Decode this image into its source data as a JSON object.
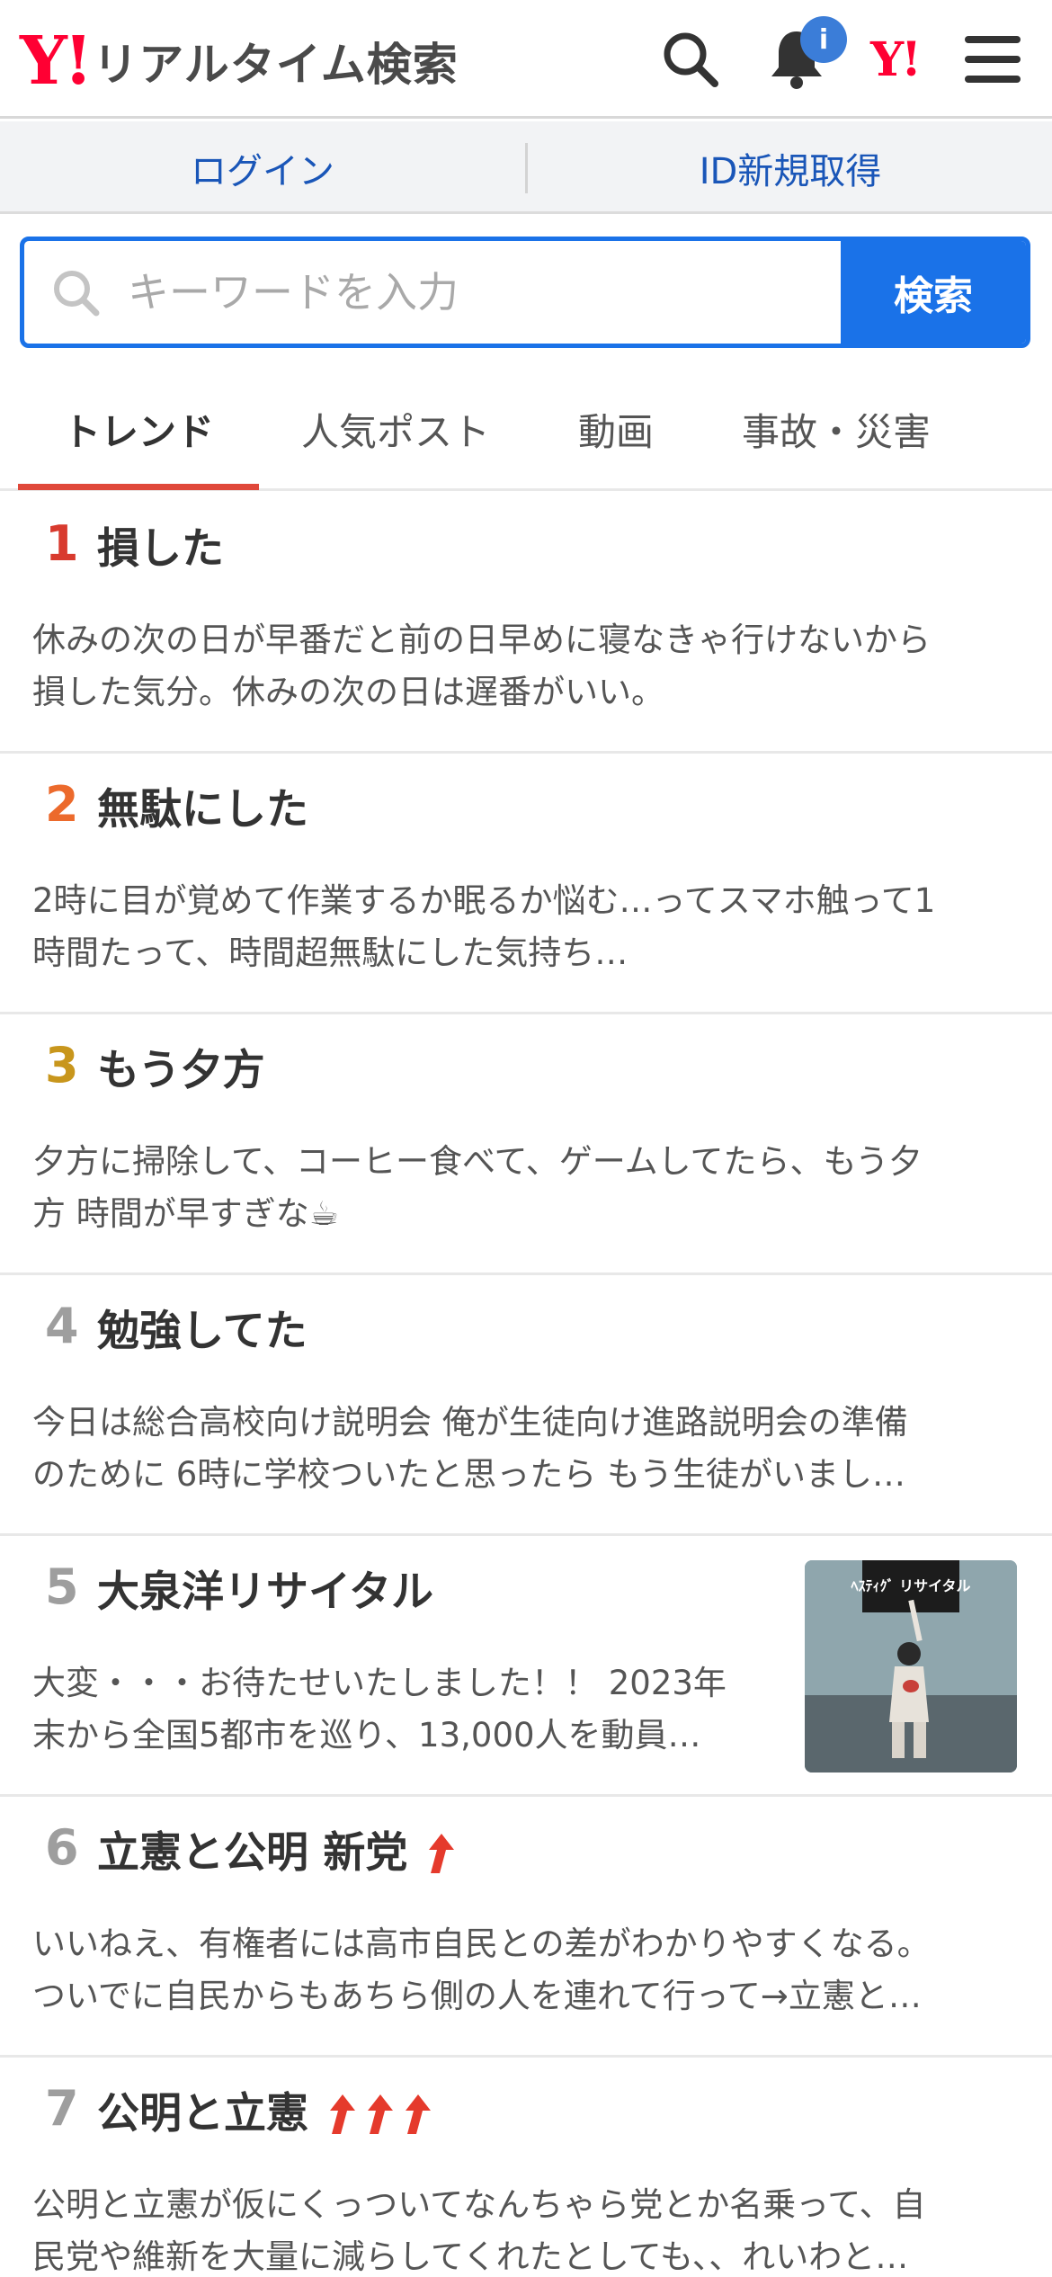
{
  "header": {
    "logo_mark": "Y!",
    "logo_text": "リアルタイム検索",
    "notification_badge": "i",
    "yj_mark": "Y!"
  },
  "login_bar": {
    "login_label": "ログイン",
    "register_label": "ID新規取得"
  },
  "search": {
    "placeholder": "キーワードを入力",
    "value": "",
    "button_label": "検索"
  },
  "tabs": [
    {
      "label": "トレンド",
      "active": true
    },
    {
      "label": "人気ポスト",
      "active": false
    },
    {
      "label": "動画",
      "active": false
    },
    {
      "label": "事故・災害",
      "active": false
    }
  ],
  "trends": [
    {
      "rank": "1",
      "rank_color": "#d83a2e",
      "title": "損した",
      "rising": 0,
      "desc_1": "休みの次の日が早番だと前の日早めに寝なきゃ行けないから",
      "desc_2": "損した気分。休みの次の日は遅番がいい。"
    },
    {
      "rank": "2",
      "rank_color": "#ec6a2c",
      "title": "無駄にした",
      "rising": 0,
      "desc_1": "2時に目が覚めて作業するか眠るか悩む…ってスマホ触って1",
      "desc_2": "時間たって、時間超無駄にした気持ち…"
    },
    {
      "rank": "3",
      "rank_color": "#c8961c",
      "title": "もう夕方",
      "rising": 0,
      "desc_1": "夕方に掃除して、コーヒー食べて、ゲームしてたら、もう夕",
      "desc_2": "方 時間が早すぎな☕ 󠄀"
    },
    {
      "rank": "4",
      "rank_color": "#9e9e9e",
      "title": "勉強してた",
      "rising": 0,
      "desc_1": "今日は総合高校向け説明会 俺が生徒向け進路説明会の準備",
      "desc_2": "のために 6時に学校ついたと思ったら もう生徒がいまし…"
    },
    {
      "rank": "5",
      "rank_color": "#9e9e9e",
      "title": "大泉洋リサイタル",
      "rising": 0,
      "desc_1": "大変・・・お待たせいたしました！！ 2023年",
      "desc_2": "末から全国5都市を巡り、13,000人を動員…"
    },
    {
      "rank": "6",
      "rank_color": "#9e9e9e",
      "title": "立憲と公明 新党",
      "rising": 1,
      "desc_1": "いいねえ、有権者には高市自民との差がわかりやすくなる。",
      "desc_2": "ついでに自民からもあちら側の人を連れて行って→立憲と…"
    },
    {
      "rank": "7",
      "rank_color": "#9e9e9e",
      "title": "公明と立憲",
      "rising": 3,
      "desc_1": "公明と立憲が仮にくっついてなんちゃら党とか名乗って、自",
      "desc_2": "民党や維新を大量に減らしてくれたとしても、、れいわと…"
    }
  ],
  "thumbnail": {
    "logo_text": "ﾍｽﾃｨｸﾞ リサイタル"
  }
}
